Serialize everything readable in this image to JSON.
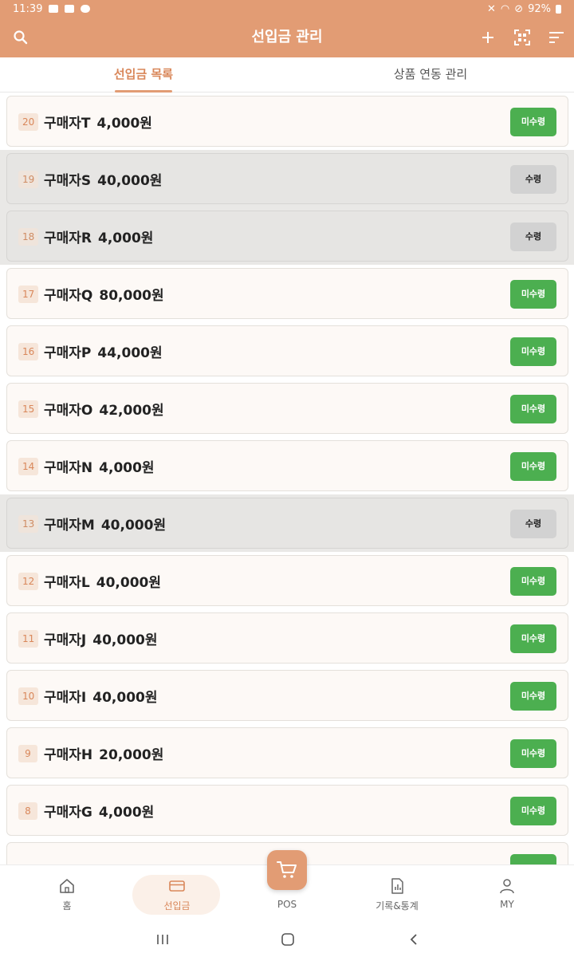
{
  "status_bar": {
    "time": "11:39",
    "battery": "92%"
  },
  "app_bar": {
    "title": "선입금 관리"
  },
  "tabs": [
    {
      "label": "선입금 목록",
      "active": true
    },
    {
      "label": "상품 연동 관리",
      "active": false
    }
  ],
  "rows": [
    {
      "num": "20",
      "buyer": "구매자T",
      "amount": "4,000원",
      "status": "미수령",
      "received": false
    },
    {
      "num": "19",
      "buyer": "구매자S",
      "amount": "40,000원",
      "status": "수령",
      "received": true
    },
    {
      "num": "18",
      "buyer": "구매자R",
      "amount": "4,000원",
      "status": "수령",
      "received": true
    },
    {
      "num": "17",
      "buyer": "구매자Q",
      "amount": "80,000원",
      "status": "미수령",
      "received": false
    },
    {
      "num": "16",
      "buyer": "구매자P",
      "amount": "44,000원",
      "status": "미수령",
      "received": false
    },
    {
      "num": "15",
      "buyer": "구매자O",
      "amount": "42,000원",
      "status": "미수령",
      "received": false
    },
    {
      "num": "14",
      "buyer": "구매자N",
      "amount": "4,000원",
      "status": "미수령",
      "received": false
    },
    {
      "num": "13",
      "buyer": "구매자M",
      "amount": "40,000원",
      "status": "수령",
      "received": true
    },
    {
      "num": "12",
      "buyer": "구매자L",
      "amount": "40,000원",
      "status": "미수령",
      "received": false
    },
    {
      "num": "11",
      "buyer": "구매자J",
      "amount": "40,000원",
      "status": "미수령",
      "received": false
    },
    {
      "num": "10",
      "buyer": "구매자I",
      "amount": "40,000원",
      "status": "미수령",
      "received": false
    },
    {
      "num": "9",
      "buyer": "구매자H",
      "amount": "20,000원",
      "status": "미수령",
      "received": false
    },
    {
      "num": "8",
      "buyer": "구매자G",
      "amount": "4,000원",
      "status": "미수령",
      "received": false
    }
  ],
  "bottom_nav": [
    {
      "label": "홈",
      "icon": "home-icon",
      "active": false
    },
    {
      "label": "선입금",
      "icon": "card-icon",
      "active": true
    },
    {
      "label": "POS",
      "icon": "cart-icon",
      "active": false
    },
    {
      "label": "기록&통계",
      "icon": "report-icon",
      "active": false
    },
    {
      "label": "MY",
      "icon": "person-icon",
      "active": false
    }
  ],
  "colors": {
    "primary": "#e29c74",
    "unreceived": "#4caf50",
    "received": "#d2d2d2"
  }
}
